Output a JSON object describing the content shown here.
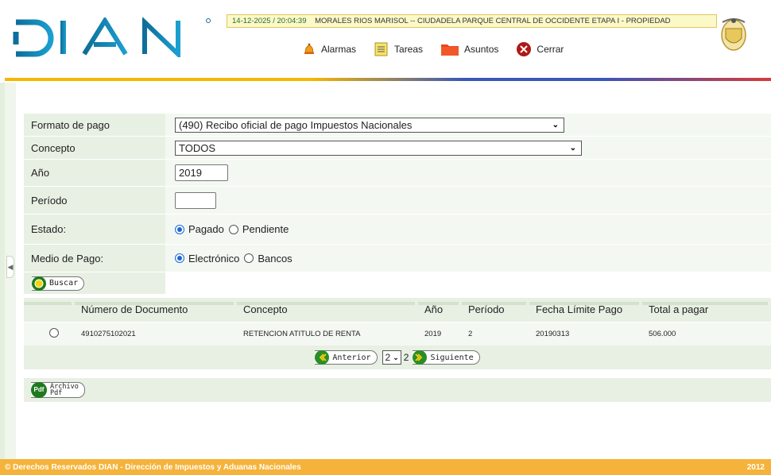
{
  "header": {
    "logo_text": "DIAN",
    "timestamp": "14-12-2025 / 20:04:39",
    "user_info": "MORALES RIOS MARISOL -- CIUDADELA PARQUE CENTRAL DE OCCIDENTE ETAPA I - PROPIEDAD",
    "toolbar": [
      {
        "label": "Alarmas",
        "icon": "bell-icon"
      },
      {
        "label": "Tareas",
        "icon": "tasks-icon"
      },
      {
        "label": "Asuntos",
        "icon": "folder-icon"
      },
      {
        "label": "Cerrar",
        "icon": "close-icon"
      }
    ]
  },
  "form": {
    "formato_label": "Formato de pago",
    "formato_value": "(490) Recibo oficial de pago Impuestos Nacionales",
    "concepto_label": "Concepto",
    "concepto_value": "TODOS",
    "anio_label": "Año",
    "anio_value": "2019",
    "periodo_label": "Período",
    "periodo_value": "",
    "estado_label": "Estado:",
    "estado_options": [
      "Pagado",
      "Pendiente"
    ],
    "estado_selected": "Pagado",
    "medio_label": "Medio de Pago:",
    "medio_options": [
      "Electrónico",
      "Bancos"
    ],
    "medio_selected": "Electrónico",
    "buscar_label": "Buscar"
  },
  "results": {
    "columns": [
      "Número de Documento",
      "Concepto",
      "Año",
      "Período",
      "Fecha Límite Pago",
      "Total a pagar"
    ],
    "rows": [
      {
        "numero": "4910275102021",
        "concepto": "RETENCION ATITULO DE RENTA",
        "anio": "2019",
        "periodo": "2",
        "fecha": "20190313",
        "total": "506.000"
      }
    ],
    "pager": {
      "anterior": "Anterior",
      "page_select": "2",
      "current": "2",
      "siguiente": "Siguiente"
    }
  },
  "pdf_button": {
    "line1": "Archivo",
    "line2": "Pdf",
    "icon_text": "Pdf"
  },
  "footer": {
    "left": "© Derechos Reservados DIAN - Dirección de Impuestos y Aduanas Nacionales",
    "right": "2012"
  },
  "colors": {
    "accent_yellow": "#f5b700",
    "accent_blue": "#3a56b8",
    "accent_red": "#d83a3a",
    "logo_blue": "#1479a6",
    "panel_green": "#e8f0e4",
    "footer": "#f5b33b"
  }
}
